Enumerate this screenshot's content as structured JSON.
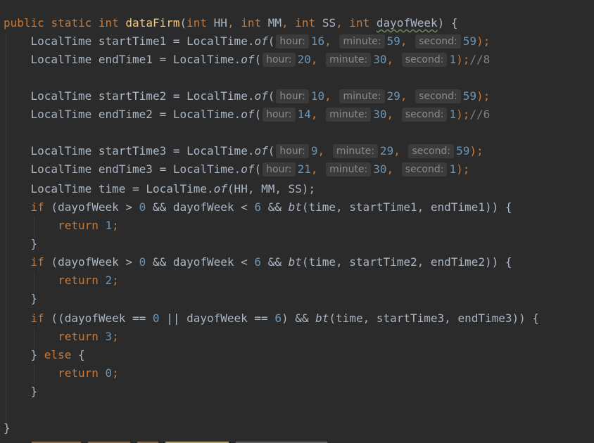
{
  "editor": {
    "colors": {
      "background": "#2b2b2b",
      "keyword": "#cc7832",
      "function": "#ffc66d",
      "number": "#6897bb",
      "text": "#a9b7c6",
      "comment": "#808080",
      "hint_background": "#3b3b3b",
      "hint_text": "#8b8b8b"
    },
    "sig": {
      "kw_public": "public",
      "kw_static": "static",
      "kw_int1": "int",
      "name": "dataFirm",
      "open": "(",
      "kw_int2": "int",
      "p_hh": " HH",
      "kw_int3": "int",
      "p_mm": " MM",
      "kw_int4": "int",
      "p_ss": " SS",
      "kw_int5": "int",
      "p_dow": "dayofWeek",
      "close": ") {"
    },
    "hints": {
      "hour": "hour:",
      "minute": "minute:",
      "second": "second:"
    },
    "decl": {
      "type": "LocalTime",
      "eq": "=",
      "cls": "LocalTime.",
      "of": "of",
      "open": "(",
      "end": ");"
    },
    "names": {
      "start1": "startTime1",
      "end1": "endTime1",
      "start2": "startTime2",
      "end2": "endTime2",
      "start3": "startTime3",
      "end3": "endTime3",
      "time": "time"
    },
    "values": {
      "s1": [
        "16",
        "59",
        "59"
      ],
      "e1": [
        "20",
        "30",
        "1"
      ],
      "s2": [
        "10",
        "29",
        "59"
      ],
      "e2": [
        "14",
        "30",
        "1"
      ],
      "s3": [
        "9",
        "29",
        "59"
      ],
      "e3": [
        "21",
        "30",
        "1"
      ]
    },
    "comments": {
      "e1": "//8",
      "e2": "//6"
    },
    "time_line": {
      "args": "(HH, MM, SS);"
    },
    "if1": {
      "kw": "if",
      "expr_a": " (dayofWeek > ",
      "n0": "0",
      "expr_b": " && dayofWeek < ",
      "n6": "6",
      "expr_c": " && ",
      "bt": "bt",
      "args": "(time, startTime1, endTime1)) {"
    },
    "if2": {
      "kw": "if",
      "expr_a": " (dayofWeek > ",
      "n0": "0",
      "expr_b": " && dayofWeek < ",
      "n6": "6",
      "expr_c": " && ",
      "bt": "bt",
      "args": "(time, startTime2, endTime2)) {"
    },
    "if3": {
      "kw": "if",
      "expr_a": " ((dayofWeek == ",
      "n0": "0",
      "expr_b": " || dayofWeek == ",
      "n6": "6",
      "expr_c": ") && ",
      "bt": "bt",
      "args": "(time, startTime3, endTime3)) {"
    },
    "ret": {
      "kw": "return",
      "v1": "1",
      "v2": "2",
      "v3": "3",
      "v0": "0",
      "semi": ";"
    },
    "brace_close": "}",
    "else_open": "} ",
    "else_kw": "else",
    "else_brace": " {"
  }
}
